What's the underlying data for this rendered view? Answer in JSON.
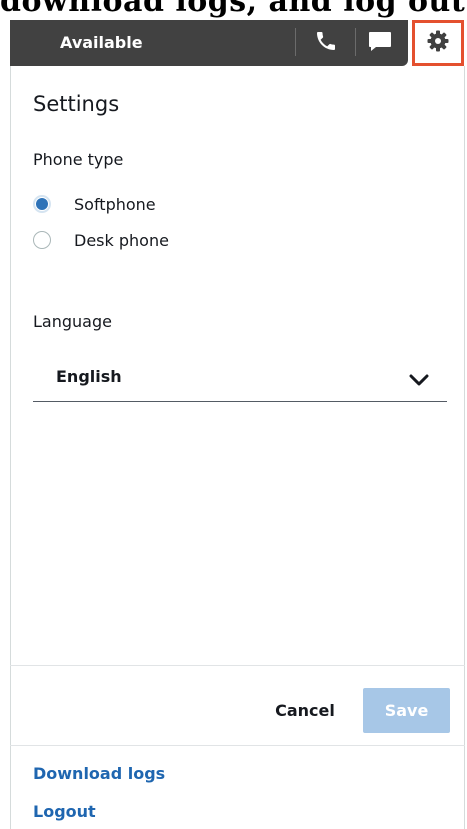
{
  "caption": "download logs, and log out.",
  "topbar": {
    "status_label": "Available",
    "icons": [
      "phone-icon",
      "chat-icon",
      "gear-icon"
    ],
    "background": "#414141"
  },
  "settings": {
    "title": "Settings",
    "phone_type": {
      "label": "Phone type",
      "options": [
        {
          "label": "Softphone",
          "checked": true
        },
        {
          "label": "Desk phone",
          "checked": false
        }
      ]
    },
    "language": {
      "label": "Language",
      "selected": "English"
    }
  },
  "footer": {
    "cancel_label": "Cancel",
    "save_label": "Save",
    "download_logs_label": "Download logs",
    "logout_label": "Logout"
  },
  "colors": {
    "accent": "#2e73b8",
    "highlight_border": "#e4502f",
    "save_disabled": "#a7c7e7",
    "link": "#1f66b0"
  }
}
